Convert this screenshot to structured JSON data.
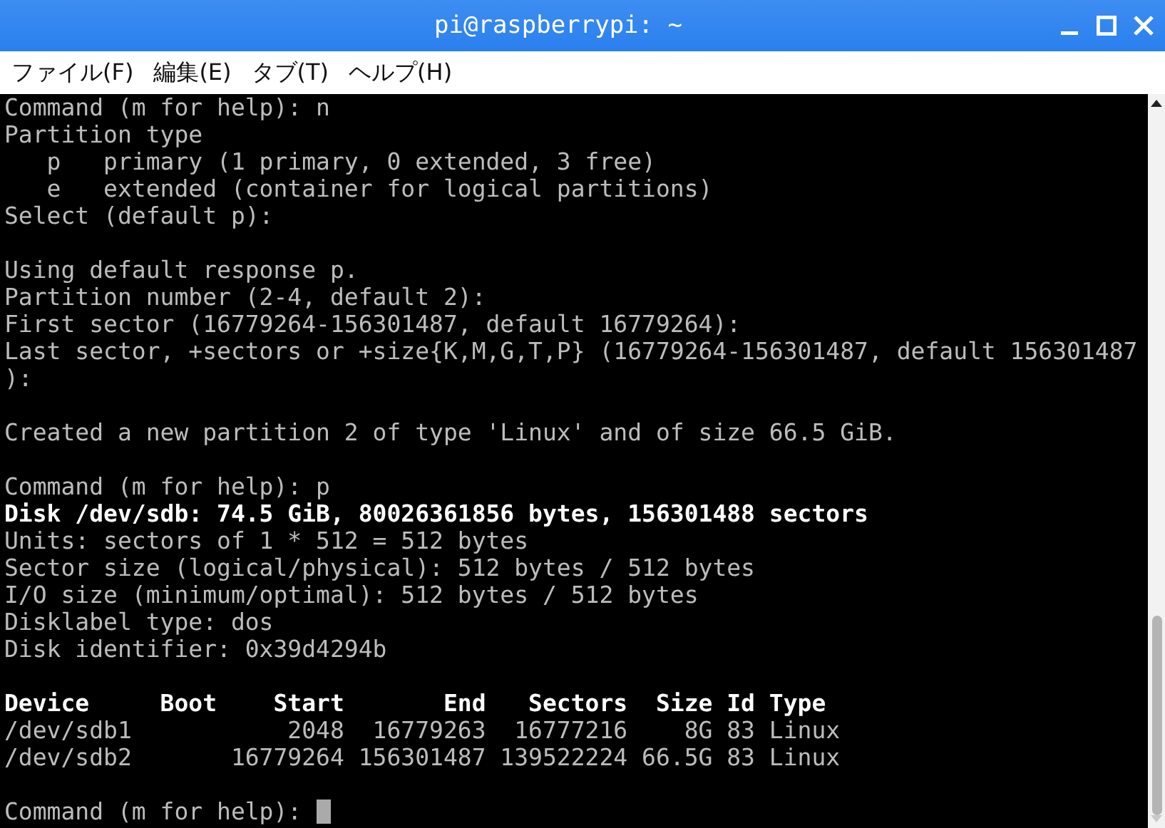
{
  "window": {
    "title": "pi@raspberrypi: ~",
    "controls": [
      {
        "kind": "minimize"
      },
      {
        "kind": "maximize"
      },
      {
        "kind": "close"
      }
    ]
  },
  "menu": [
    {
      "label": "ファイル(F)"
    },
    {
      "label": "編集(E)"
    },
    {
      "label": "タブ(T)"
    },
    {
      "label": "ヘルプ(H)"
    }
  ],
  "terminal": {
    "lines": [
      {
        "kind": "text",
        "text": "Command (m for help): n",
        "bold": false
      },
      {
        "kind": "text",
        "text": "Partition type",
        "bold": false
      },
      {
        "kind": "text",
        "text": "   p   primary (1 primary, 0 extended, 3 free)",
        "bold": false
      },
      {
        "kind": "text",
        "text": "   e   extended (container for logical partitions)",
        "bold": false
      },
      {
        "kind": "text",
        "text": "Select (default p):",
        "bold": false
      },
      {
        "kind": "blank"
      },
      {
        "kind": "text",
        "text": "Using default response p.",
        "bold": false
      },
      {
        "kind": "text",
        "text": "Partition number (2-4, default 2):",
        "bold": false
      },
      {
        "kind": "text",
        "text": "First sector (16779264-156301487, default 16779264):",
        "bold": false
      },
      {
        "kind": "text",
        "text": "Last sector, +sectors or +size{K,M,G,T,P} (16779264-156301487, default 156301487",
        "bold": false
      },
      {
        "kind": "text",
        "text": "):",
        "bold": false
      },
      {
        "kind": "blank"
      },
      {
        "kind": "text",
        "text": "Created a new partition 2 of type 'Linux' and of size 66.5 GiB.",
        "bold": false
      },
      {
        "kind": "blank"
      },
      {
        "kind": "text",
        "text": "Command (m for help): p",
        "bold": false
      },
      {
        "kind": "text",
        "text": "Disk /dev/sdb: 74.5 GiB, 80026361856 bytes, 156301488 sectors",
        "bold": true
      },
      {
        "kind": "text",
        "text": "Units: sectors of 1 * 512 = 512 bytes",
        "bold": false
      },
      {
        "kind": "text",
        "text": "Sector size (logical/physical): 512 bytes / 512 bytes",
        "bold": false
      },
      {
        "kind": "text",
        "text": "I/O size (minimum/optimal): 512 bytes / 512 bytes",
        "bold": false
      },
      {
        "kind": "text",
        "text": "Disklabel type: dos",
        "bold": false
      },
      {
        "kind": "text",
        "text": "Disk identifier: 0x39d4294b",
        "bold": false
      },
      {
        "kind": "blank"
      },
      {
        "kind": "text",
        "text": "Device     Boot    Start       End   Sectors  Size Id Type",
        "bold": true
      },
      {
        "kind": "text",
        "text": "/dev/sdb1           2048  16779263  16777216    8G 83 Linux",
        "bold": false
      },
      {
        "kind": "text",
        "text": "/dev/sdb2       16779264 156301487 139522224 66.5G 83 Linux",
        "bold": false
      },
      {
        "kind": "blank"
      },
      {
        "kind": "input",
        "text": "Command (m for help): ",
        "bold": false
      }
    ]
  }
}
